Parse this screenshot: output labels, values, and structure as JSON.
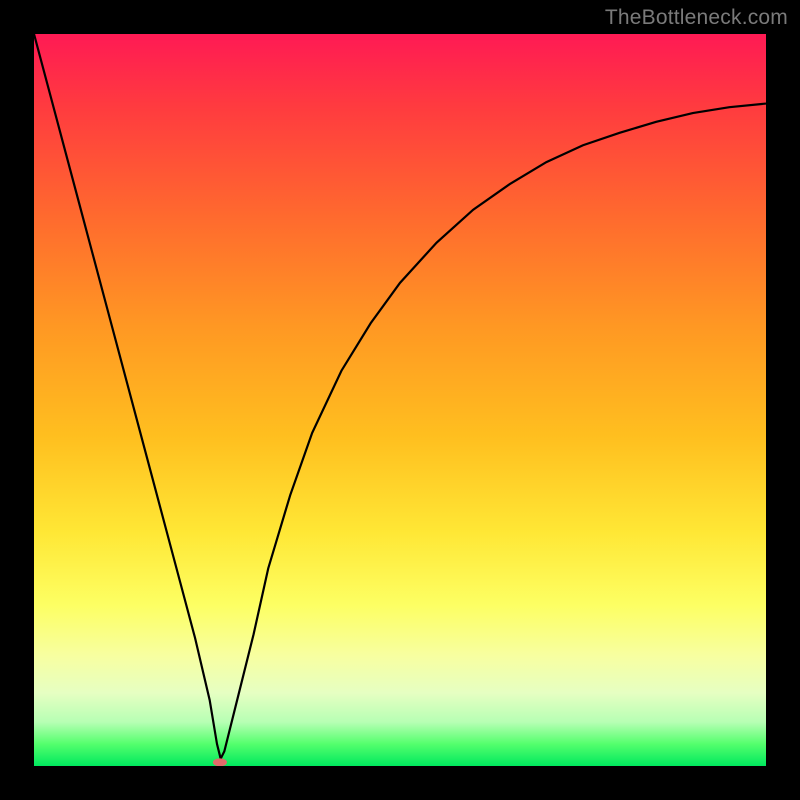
{
  "watermark": {
    "text": "TheBottleneck.com"
  },
  "chart_data": {
    "type": "line",
    "title": "",
    "xlabel": "",
    "ylabel": "",
    "xlim": [
      0,
      100
    ],
    "ylim": [
      0,
      100
    ],
    "grid": false,
    "background": "red-yellow-green vertical gradient",
    "series": [
      {
        "name": "curve",
        "x": [
          0,
          2,
          4,
          6,
          8,
          10,
          12,
          14,
          16,
          18,
          20,
          22,
          24,
          25,
          25.5,
          26,
          28,
          30,
          32,
          35,
          38,
          42,
          46,
          50,
          55,
          60,
          65,
          70,
          75,
          80,
          85,
          90,
          95,
          100
        ],
        "y": [
          100,
          92.5,
          85,
          77.5,
          70,
          62.5,
          55,
          47.5,
          40,
          32.5,
          25,
          17.5,
          9,
          3,
          1,
          2,
          10,
          18,
          27,
          37,
          45.5,
          54,
          60.5,
          66,
          71.5,
          76,
          79.5,
          82.5,
          84.8,
          86.5,
          88,
          89.2,
          90,
          90.5
        ]
      }
    ],
    "marker": {
      "x": 25.4,
      "y": 0.5,
      "color": "#e06a6a",
      "rx": 7,
      "ry": 4
    }
  }
}
